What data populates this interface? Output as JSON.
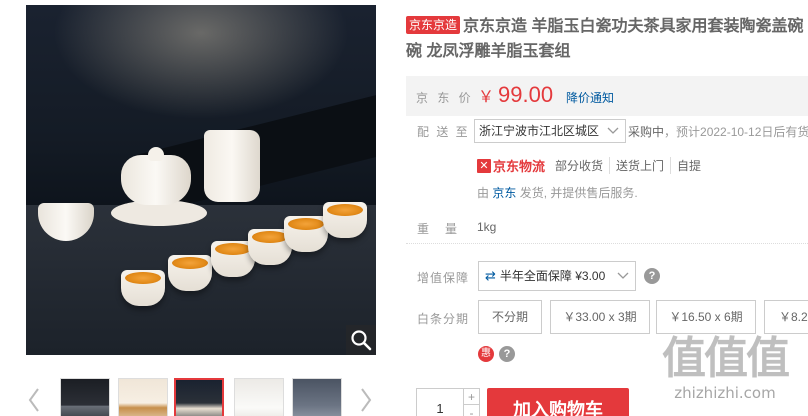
{
  "gallery": {
    "thumbnails_count": 6,
    "active_thumbnail": 3,
    "magnifier_icon": "magnifier-icon",
    "prev_icon": "chevron-left-icon",
    "next_icon": "chevron-right-icon"
  },
  "product": {
    "badge": "京东京造",
    "title": "京东京造 羊脂玉白瓷功夫茶具家用套装陶瓷盖碗碗 龙凤浮雕羊脂玉套组",
    "title_line1": "京东京造 羊脂玉白瓷功夫茶具家用套装陶瓷盖碗",
    "title_line2": "碗 龙凤浮雕羊脂玉套组"
  },
  "price": {
    "label": "京 东 价",
    "currency": "￥",
    "amount": "99.00",
    "notify": "降价通知"
  },
  "delivery": {
    "label": "配 送 至",
    "address": "浙江宁波市江北区城区",
    "status": "采购中",
    "eta": "，预计2022-10-12日后有货"
  },
  "logistics": {
    "brand": "京东物流",
    "services": [
      "部分收货",
      "送货上门",
      "自提"
    ],
    "seller_prefix": "由 ",
    "seller_name": "京东",
    "seller_suffix": " 发货, 并提供售后服务."
  },
  "weight": {
    "label": "重量",
    "value": "1kg"
  },
  "value_added": {
    "label": "增值保障",
    "option": "半年全面保障 ¥3.00"
  },
  "installment": {
    "label": "白条分期",
    "options": [
      "不分期",
      "￥33.00 x 3期",
      "￥16.50 x 6期",
      "￥8.2"
    ]
  },
  "promo": {
    "hui_label": "惠"
  },
  "purchase": {
    "quantity": "1",
    "plus": "+",
    "minus": "-",
    "add_to_cart": "加入购物车"
  },
  "watermark": {
    "top": "值值值",
    "bottom": "zhizhizhi.com"
  },
  "colors": {
    "accent_red": "#e4393c",
    "link_blue": "#005aa0",
    "price_bg": "#f3f3f3"
  }
}
